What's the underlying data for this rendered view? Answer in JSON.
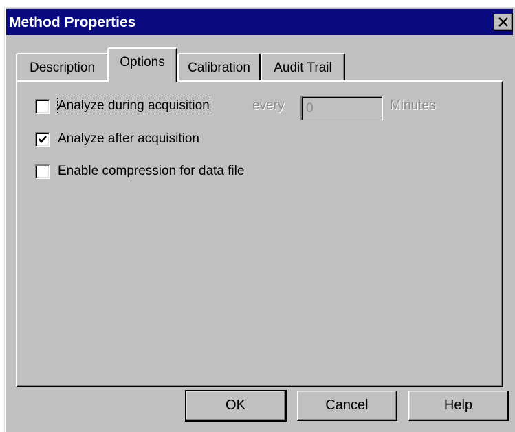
{
  "window": {
    "title": "Method Properties"
  },
  "tabs": [
    {
      "label": "Description"
    },
    {
      "label": "Options"
    },
    {
      "label": "Calibration"
    },
    {
      "label": "Audit Trail"
    }
  ],
  "active_tab": "Options",
  "options": {
    "analyze_during": {
      "label": "Analyze during acquisition",
      "checked": false,
      "every_label": "every",
      "interval_value": "0",
      "minutes_label": "Minutes"
    },
    "analyze_after": {
      "label": "Analyze after acquisition",
      "checked": true
    },
    "compression": {
      "label": "Enable compression for data file",
      "checked": false
    }
  },
  "buttons": {
    "ok": "OK",
    "cancel": "Cancel",
    "help": "Help"
  },
  "colors": {
    "titlebar": "#0a0a80",
    "face": "#c0c0c0",
    "disabled_text": "#8c8c8c"
  },
  "icons": {
    "close": "close-icon",
    "check": "checkmark-icon"
  }
}
